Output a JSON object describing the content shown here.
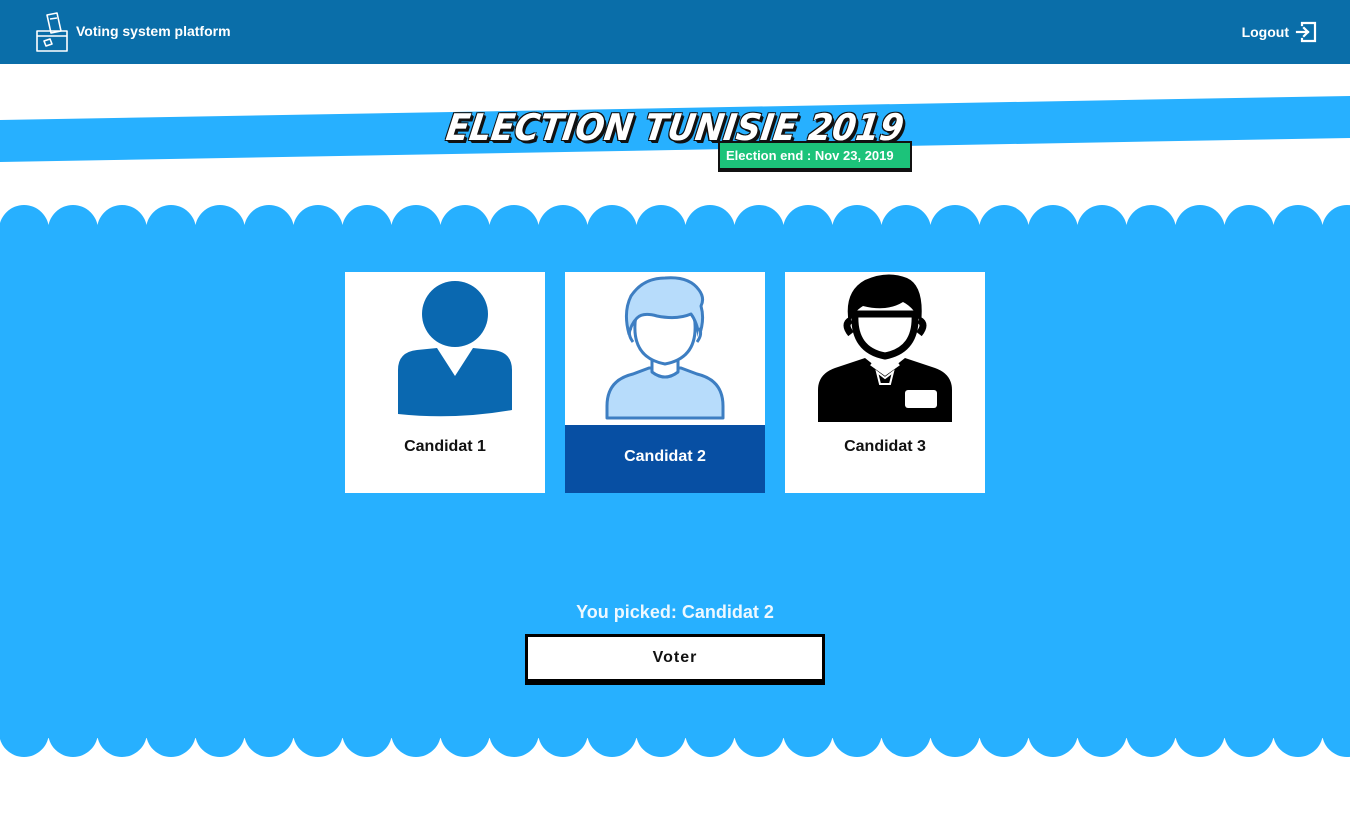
{
  "app": {
    "name": "Voting system platform",
    "logout_label": "Logout"
  },
  "election": {
    "title": "ELECTION TUNISIE 2019",
    "end_label": "Election end : Nov 23, 2019"
  },
  "candidates": [
    {
      "label": "Candidat 1",
      "avatar": "person-silhouette-icon",
      "selected": false
    },
    {
      "label": "Candidat 2",
      "avatar": "person-outline-icon",
      "selected": true
    },
    {
      "label": "Candidat 3",
      "avatar": "person-suit-icon",
      "selected": false
    }
  ],
  "selection": {
    "picked_text": "You picked: Candidat 2"
  },
  "actions": {
    "vote_label": "Voter"
  },
  "colors": {
    "navbar": "#0a6ea9",
    "band": "#27b0ff",
    "selected_card": "#074fa3",
    "badge": "#1cc37a"
  }
}
